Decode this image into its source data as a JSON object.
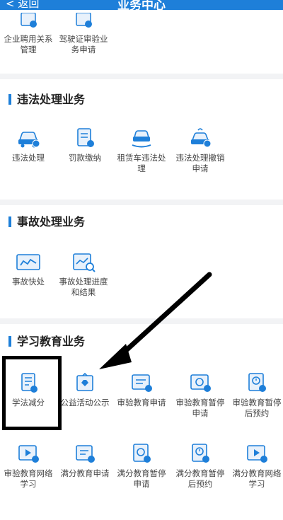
{
  "header": {
    "back_label": "< 返回",
    "title": "业务中心"
  },
  "top_items": [
    {
      "label": "企业聘用关系管理",
      "icon": "employment-icon"
    },
    {
      "label": "驾驶证审验业务申请",
      "icon": "license-review-icon"
    }
  ],
  "sections": [
    {
      "title": "违法处理业务",
      "items": [
        {
          "label": "违法处理",
          "icon": "car-icon"
        },
        {
          "label": "罚款缴纳",
          "icon": "fine-payment-icon"
        },
        {
          "label": "租赁车违法处理",
          "icon": "rental-car-icon"
        },
        {
          "label": "违法处理撤销申请",
          "icon": "revoke-icon"
        }
      ]
    },
    {
      "title": "事故处理业务",
      "items": [
        {
          "label": "事故快处",
          "icon": "accident-quick-icon"
        },
        {
          "label": "事故处理进度和结果",
          "icon": "accident-progress-icon"
        }
      ]
    },
    {
      "title": "学习教育业务",
      "items": [
        {
          "label": "学法减分",
          "icon": "study-law-icon"
        },
        {
          "label": "公益活动公示",
          "icon": "charity-icon"
        },
        {
          "label": "审验教育申请",
          "icon": "education-apply-icon"
        },
        {
          "label": "审验教育暂停申请",
          "icon": "education-pause-icon"
        },
        {
          "label": "审验教育暂停后预约",
          "icon": "education-appointment-icon"
        },
        {
          "label": "审验教育网络学习",
          "icon": "online-study-icon"
        },
        {
          "label": "满分教育申请",
          "icon": "full-score-apply-icon"
        },
        {
          "label": "满分教育暂停申请",
          "icon": "full-score-pause-icon"
        },
        {
          "label": "满分教育暂停后预约",
          "icon": "full-score-appointment-icon"
        },
        {
          "label": "满分教育网络学习",
          "icon": "full-score-online-icon"
        }
      ]
    }
  ],
  "colors": {
    "accent": "#1e7fd9",
    "icon_bg": "#e8f1fb"
  }
}
